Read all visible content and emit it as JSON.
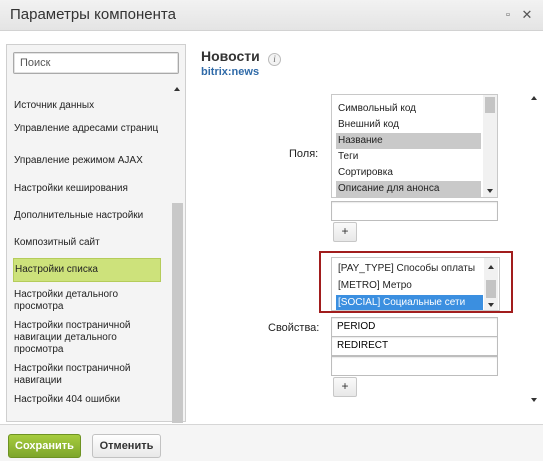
{
  "window": {
    "title": "Параметры компонента",
    "minimize_glyph": "▫",
    "close_glyph": "✕"
  },
  "sidebar": {
    "search_placeholder": "Поиск",
    "items": [
      {
        "label": "Источник данных"
      },
      {
        "label": "Управление адресами страниц"
      },
      {
        "label": "Управление режимом AJAX"
      },
      {
        "label": "Настройки кеширования"
      },
      {
        "label": "Дополнительные настройки"
      },
      {
        "label": "Композитный сайт"
      },
      {
        "label": "Настройки списка",
        "active": true
      },
      {
        "label": "Настройки детального просмотра"
      },
      {
        "label": "Настройки постраничной навигации детального просмотра"
      },
      {
        "label": "Настройки постраничной навигации"
      },
      {
        "label": "Настройки 404 ошибки"
      }
    ]
  },
  "main": {
    "title": "Новости",
    "subtitle": "bitrix:news",
    "info_glyph": "i",
    "fields": {
      "label": "Поля:",
      "options": [
        {
          "label": "Символьный код",
          "selected": false
        },
        {
          "label": "Внешний код",
          "selected": false
        },
        {
          "label": "Название",
          "selected": true
        },
        {
          "label": "Теги",
          "selected": false
        },
        {
          "label": "Сортировка",
          "selected": false
        },
        {
          "label": "Описание для анонса",
          "selected": true
        }
      ],
      "input_value": "",
      "add_label": "+"
    },
    "properties": {
      "label": "Свойства:",
      "options": [
        {
          "label": "[PAY_TYPE] Способы оплаты",
          "selected": false
        },
        {
          "label": "[METRO] Метро",
          "selected": false
        },
        {
          "label": "[SOCIAL] Социальные сети",
          "selected": true
        }
      ],
      "inputs": [
        "PERIOD",
        "REDIRECT",
        ""
      ],
      "add_label": "+"
    }
  },
  "footer": {
    "save_label": "Сохранить",
    "cancel_label": "Отменить"
  },
  "colors": {
    "active_item": "#cde27b",
    "save_button": "#8cb52f",
    "selection_blue": "#3b8fe0",
    "highlight_frame": "#a11d1d"
  }
}
